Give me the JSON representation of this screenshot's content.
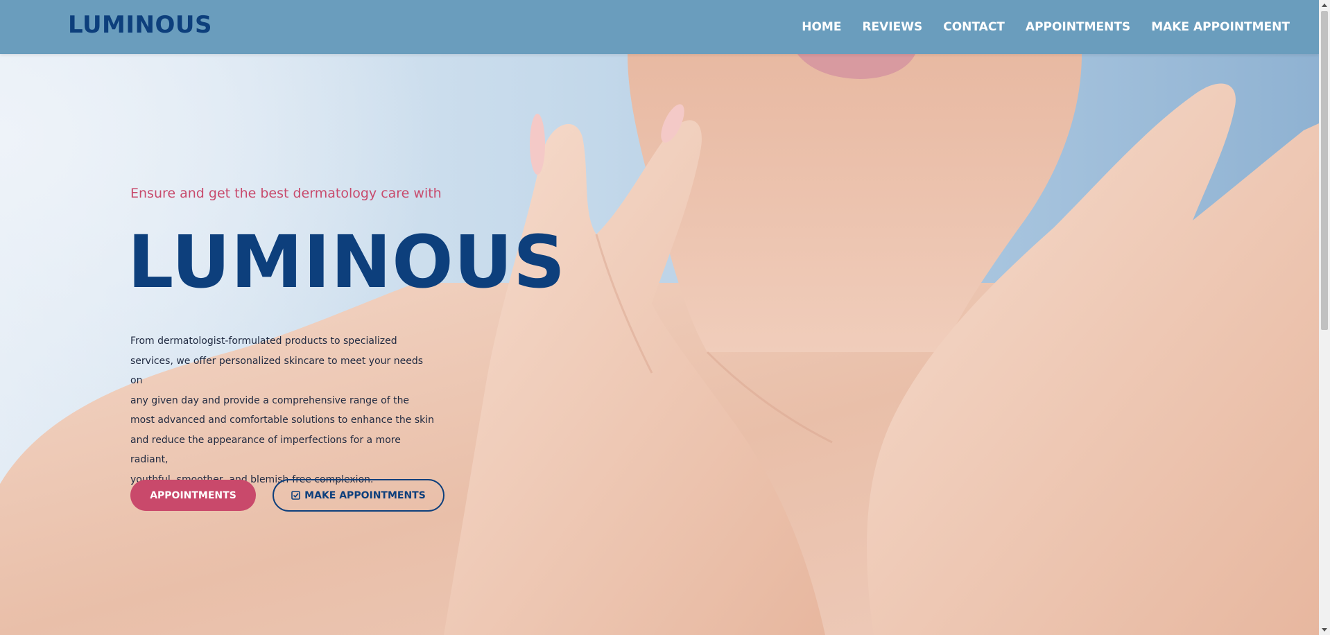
{
  "brand": {
    "logo": "LUMINOUS"
  },
  "nav": {
    "items": [
      "HOME",
      "REVIEWS",
      "CONTACT",
      "APPOINTMENTS",
      "MAKE APPOINTMENT"
    ]
  },
  "hero": {
    "kicker": "Ensure and get the best dermatology care with",
    "headline": "LUMINOUS",
    "description_lines": [
      "From dermatologist-formulated products to specialized",
      "services, we offer personalized skincare to meet your needs on",
      "any given day and provide a comprehensive range of the",
      "most advanced and comfortable solutions to enhance the skin",
      "and reduce the appearance of imperfections for a more radiant,",
      "youthful, smoother, and blemish-free complexion."
    ],
    "primary_button": "APPOINTMENTS",
    "secondary_button": "MAKE APPOINTMENTS",
    "secondary_button_icon": "check-square-icon",
    "image": "skincare-model-hands-on-face"
  },
  "colors": {
    "navbar": "#6a9dbd",
    "brand_blue": "#0d3f7c",
    "accent_pink": "#c9496b"
  }
}
